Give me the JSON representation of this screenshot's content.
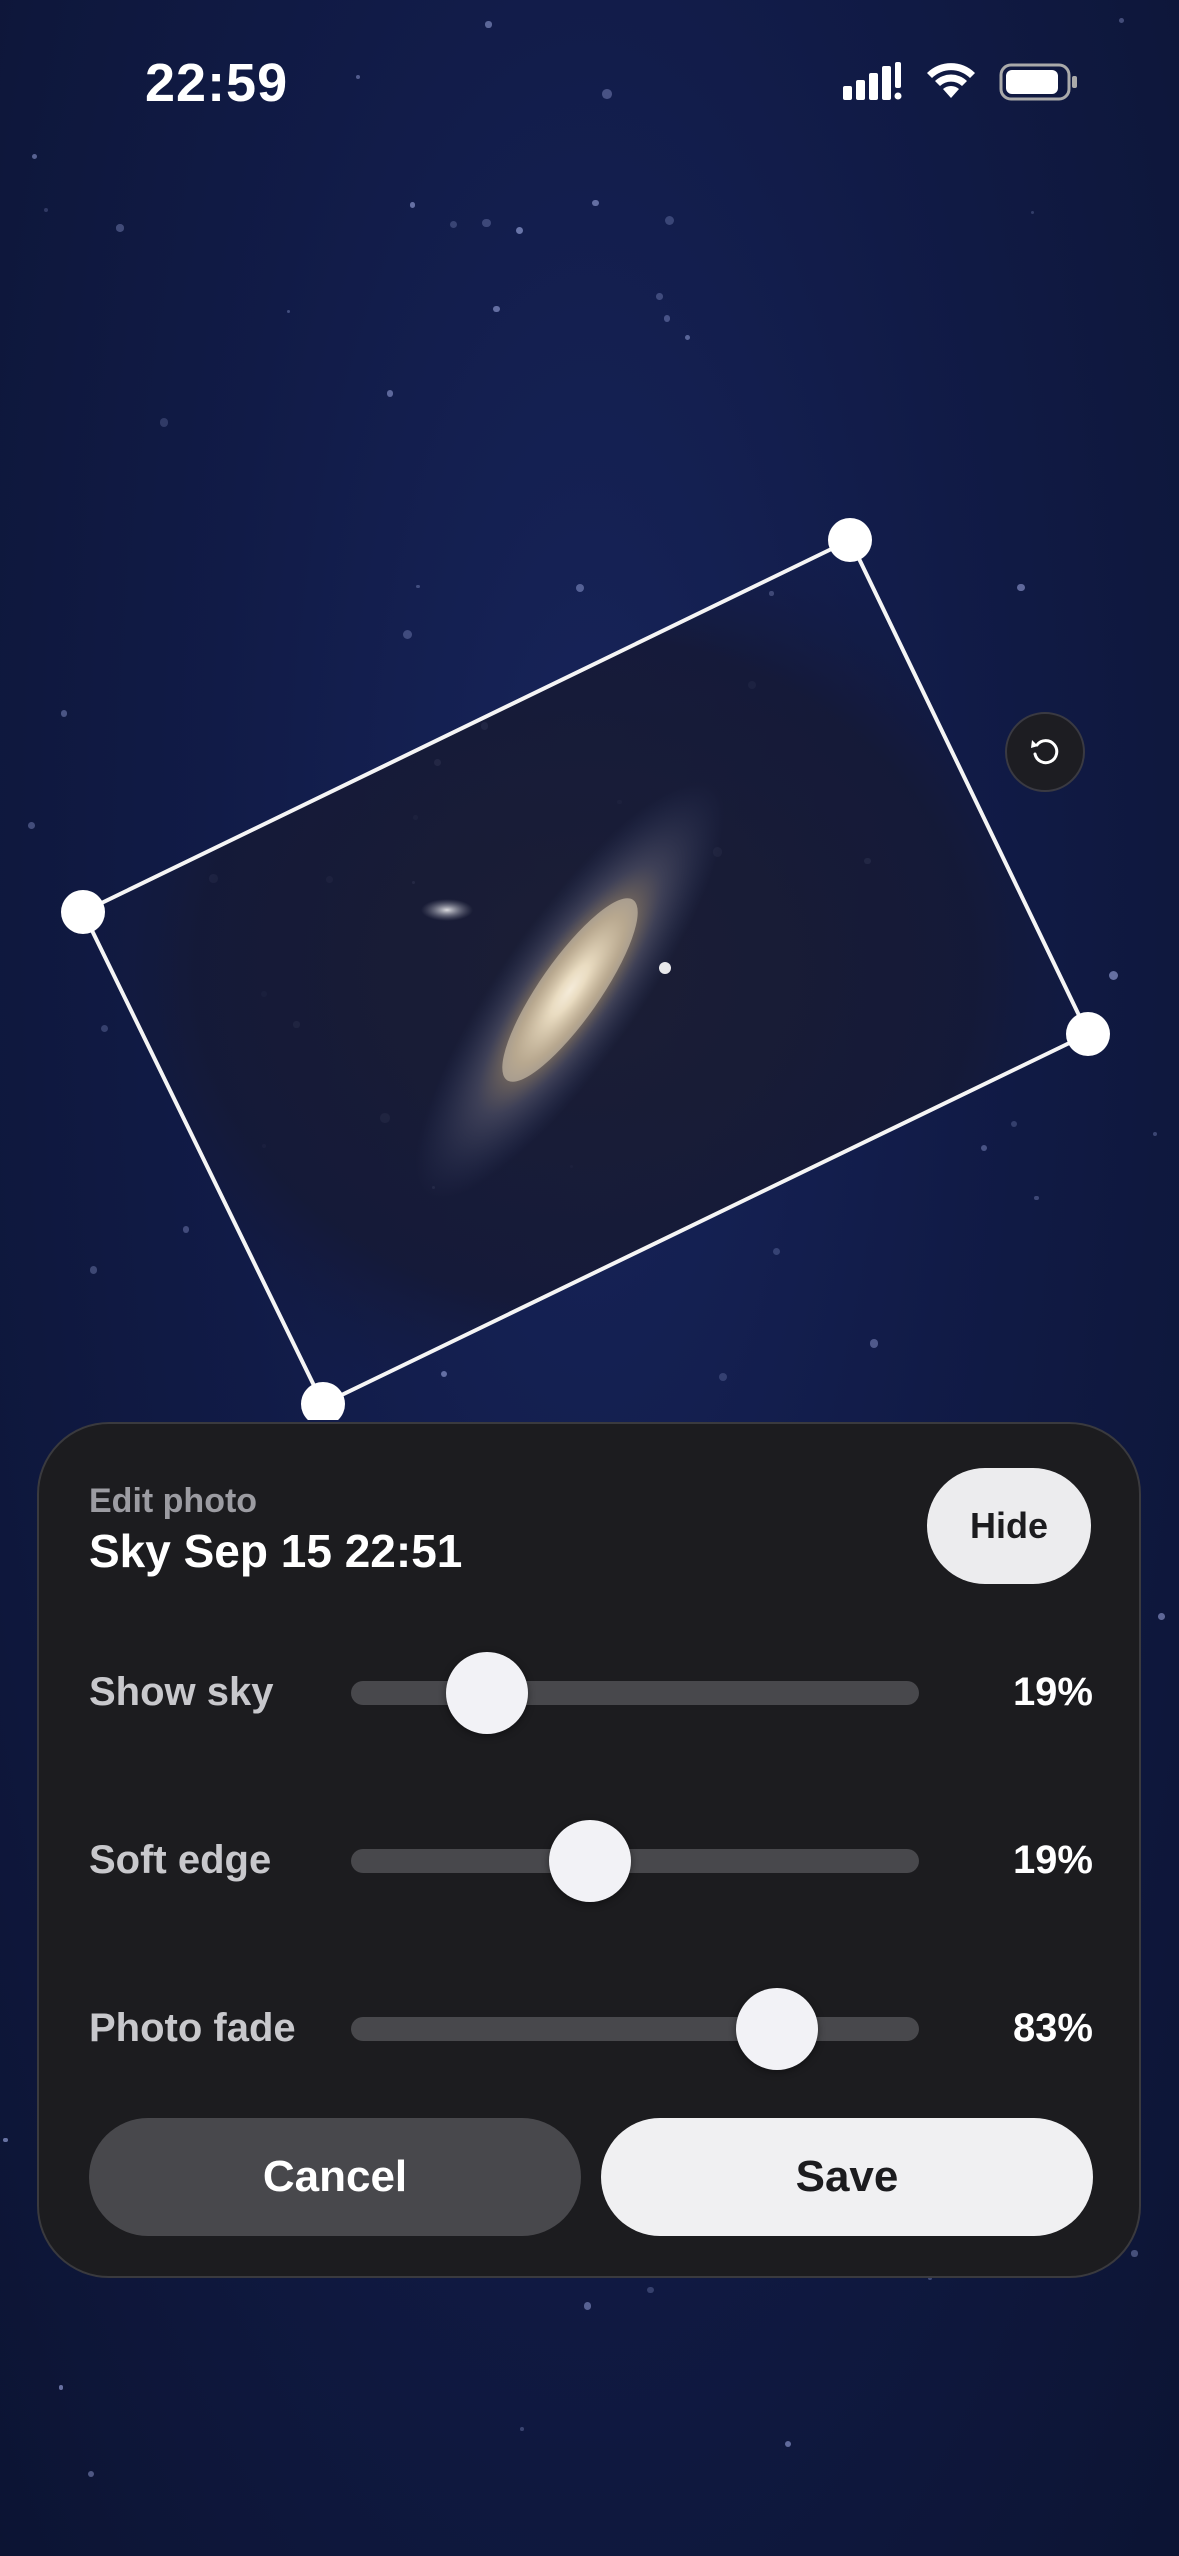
{
  "status_bar": {
    "time": "22:59"
  },
  "photo": {
    "rotate_icon": "rotate-ccw-icon"
  },
  "panel": {
    "subtitle": "Edit photo",
    "title": "Sky Sep 15 22:51",
    "hide_label": "Hide",
    "sliders": [
      {
        "label": "Show sky",
        "value_text": "19%",
        "position": 0.24
      },
      {
        "label": "Soft edge",
        "value_text": "19%",
        "position": 0.42
      },
      {
        "label": "Photo fade",
        "value_text": "83%",
        "position": 0.75
      }
    ],
    "cancel_label": "Cancel",
    "save_label": "Save"
  },
  "colors": {
    "sky": "#111b47",
    "panel": "#1c1c1f",
    "accent": "#f0f0f2"
  }
}
